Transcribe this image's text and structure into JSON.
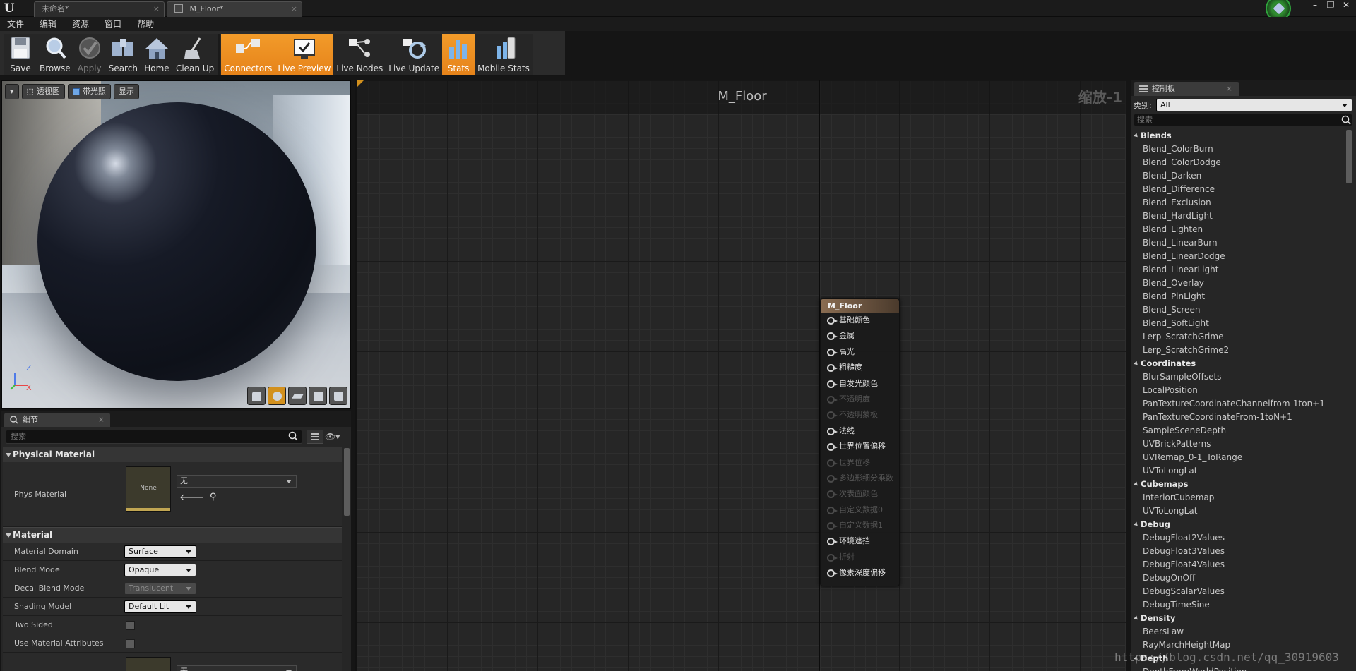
{
  "tabs": [
    {
      "label": "未命名*",
      "active": false
    },
    {
      "label": "M_Floor*",
      "active": true
    }
  ],
  "menu": [
    "文件",
    "编辑",
    "资源",
    "窗口",
    "帮助"
  ],
  "toolbar": [
    {
      "label": "Save",
      "icon": "save-icon",
      "state": "normal"
    },
    {
      "label": "Browse",
      "icon": "browse-icon",
      "state": "normal"
    },
    {
      "label": "Apply",
      "icon": "apply-icon",
      "state": "disabled"
    },
    {
      "label": "Search",
      "icon": "search-icon",
      "state": "normal"
    },
    {
      "label": "Home",
      "icon": "home-icon",
      "state": "normal"
    },
    {
      "label": "Clean Up",
      "icon": "clean-up-icon",
      "state": "normal"
    },
    {
      "label": "Connectors",
      "icon": "connectors-icon",
      "state": "active"
    },
    {
      "label": "Live Preview",
      "icon": "live-preview-icon",
      "state": "active"
    },
    {
      "label": "Live Nodes",
      "icon": "live-nodes-icon",
      "state": "normal"
    },
    {
      "label": "Live Update",
      "icon": "live-update-icon",
      "state": "normal"
    },
    {
      "label": "Stats",
      "icon": "stats-icon",
      "state": "active"
    },
    {
      "label": "Mobile Stats",
      "icon": "mobile-stats-icon",
      "state": "normal"
    }
  ],
  "viewport": {
    "perspective_label": "透视图",
    "lit_label": "带光照",
    "show_label": "显示",
    "axis_z": "Z",
    "axis_x": "X"
  },
  "details": {
    "tab_label": "细节",
    "search_placeholder": "搜索",
    "physical_material_header": "Physical Material",
    "phys_material_label": "Phys Material",
    "phys_thumb_label": "None",
    "phys_value": "无",
    "material_header": "Material",
    "props": [
      {
        "name": "Material Domain",
        "value": "Surface",
        "type": "dropdown",
        "enabled": true
      },
      {
        "name": "Blend Mode",
        "value": "Opaque",
        "type": "dropdown",
        "enabled": true
      },
      {
        "name": "Decal Blend Mode",
        "value": "Translucent",
        "type": "dropdown",
        "enabled": false
      },
      {
        "name": "Shading Model",
        "value": "Default Lit",
        "type": "dropdown",
        "enabled": true
      },
      {
        "name": "Two Sided",
        "value": "",
        "type": "checkbox",
        "enabled": true
      },
      {
        "name": "Use Material Attributes",
        "value": "",
        "type": "checkbox",
        "enabled": true
      }
    ],
    "next_value": "无"
  },
  "graph": {
    "title": "M_Floor",
    "zoom": "缩放-1",
    "node": {
      "title": "M_Floor",
      "pins": [
        {
          "label": "基础颜色",
          "enabled": true
        },
        {
          "label": "金属",
          "enabled": true
        },
        {
          "label": "高光",
          "enabled": true
        },
        {
          "label": "粗糙度",
          "enabled": true
        },
        {
          "label": "自发光颜色",
          "enabled": true
        },
        {
          "label": "不透明度",
          "enabled": false
        },
        {
          "label": "不透明蒙板",
          "enabled": false
        },
        {
          "label": "法线",
          "enabled": true
        },
        {
          "label": "世界位置偏移",
          "enabled": true
        },
        {
          "label": "世界位移",
          "enabled": false
        },
        {
          "label": "多边形细分乘数",
          "enabled": false
        },
        {
          "label": "次表面颜色",
          "enabled": false
        },
        {
          "label": "自定义数据0",
          "enabled": false
        },
        {
          "label": "自定义数据1",
          "enabled": false
        },
        {
          "label": "环境遮挡",
          "enabled": true
        },
        {
          "label": "折射",
          "enabled": false
        },
        {
          "label": "像素深度偏移",
          "enabled": true
        }
      ]
    }
  },
  "palette": {
    "tab_label": "控制板",
    "category_label": "类别:",
    "category_value": "All",
    "search_placeholder": "搜索",
    "sections": [
      {
        "name": "Blends",
        "items": [
          "Blend_ColorBurn",
          "Blend_ColorDodge",
          "Blend_Darken",
          "Blend_Difference",
          "Blend_Exclusion",
          "Blend_HardLight",
          "Blend_Lighten",
          "Blend_LinearBurn",
          "Blend_LinearDodge",
          "Blend_LinearLight",
          "Blend_Overlay",
          "Blend_PinLight",
          "Blend_Screen",
          "Blend_SoftLight",
          "Lerp_ScratchGrime",
          "Lerp_ScratchGrime2"
        ]
      },
      {
        "name": "Coordinates",
        "items": [
          "BlurSampleOffsets",
          "LocalPosition",
          "PanTextureCoordinateChannelfrom-1ton+1",
          "PanTextureCoordinateFrom-1toN+1",
          "SampleSceneDepth",
          "UVBrickPatterns",
          "UVRemap_0-1_ToRange",
          "UVToLongLat"
        ]
      },
      {
        "name": "Cubemaps",
        "items": [
          "InteriorCubemap",
          "UVToLongLat"
        ]
      },
      {
        "name": "Debug",
        "items": [
          "DebugFloat2Values",
          "DebugFloat3Values",
          "DebugFloat4Values",
          "DebugOnOff",
          "DebugScalarValues",
          "DebugTimeSine"
        ]
      },
      {
        "name": "Density",
        "items": [
          "BeersLaw",
          "RayMarchHeightMap"
        ]
      },
      {
        "name": "Depth",
        "items": [
          "DepthFromWorldPosition"
        ]
      }
    ]
  },
  "watermark": "https://blog.csdn.net/qq_30919603",
  "colors": {
    "accent_orange": "#f29b2a",
    "node_header": "#8a6d52",
    "background": "#262626"
  }
}
